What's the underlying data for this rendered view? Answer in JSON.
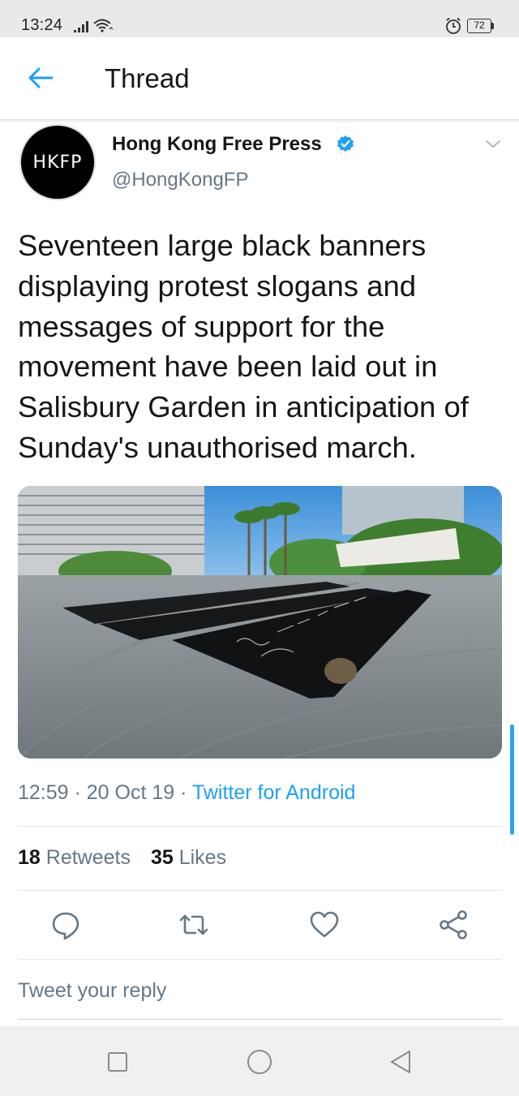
{
  "status_bar": {
    "time": "13:24",
    "battery": "72",
    "icons": [
      "signal-icon",
      "wifi-icon",
      "alarm-icon",
      "battery-icon"
    ]
  },
  "header": {
    "title": "Thread",
    "back_icon": "arrow-left-icon"
  },
  "tweet": {
    "avatar_text": "HKFP",
    "display_name": "Hong Kong Free Press",
    "handle": "@HongKongFP",
    "verified": true,
    "text": "Seventeen large black banners displaying protest slogans and messages of support for the movement have been laid out in Salisbury Garden in anticipation of Sunday's unauthorised march.",
    "time": "12:59",
    "date": "20 Oct 19",
    "separator": " · ",
    "source": "Twitter for Android",
    "retweets_count": "18",
    "retweets_label": "Retweets",
    "likes_count": "35",
    "likes_label": "Likes"
  },
  "actions": [
    {
      "name": "reply-button",
      "icon": "speech-bubble-icon"
    },
    {
      "name": "retweet-button",
      "icon": "retweet-icon"
    },
    {
      "name": "like-button",
      "icon": "heart-icon"
    },
    {
      "name": "share-button",
      "icon": "share-icon"
    }
  ],
  "reply": {
    "placeholder": "Tweet your reply"
  },
  "colors": {
    "accent": "#1da1f2",
    "secondary_text": "#657786",
    "primary_text": "#14171a"
  },
  "nav_bar": {
    "icons": [
      "recent-apps-icon",
      "home-icon",
      "back-icon"
    ]
  }
}
